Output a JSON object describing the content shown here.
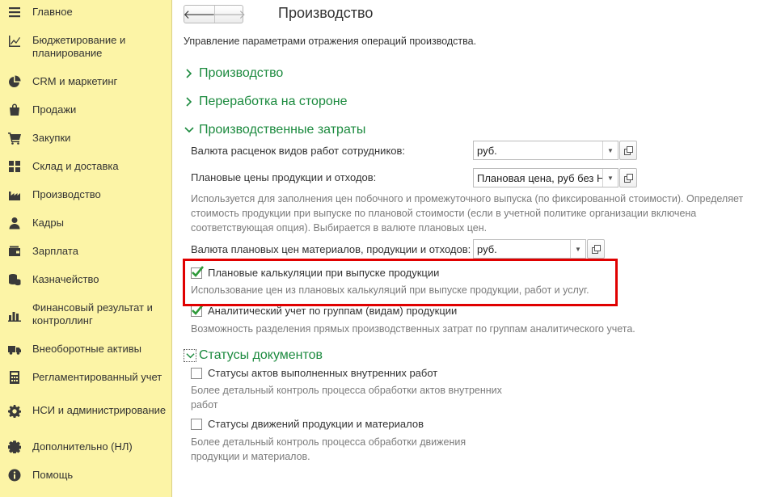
{
  "sidebar": {
    "items": [
      {
        "label": "Главное",
        "icon": "menu-icon"
      },
      {
        "label": "Бюджетирование и планирование",
        "icon": "chart-icon"
      },
      {
        "label": "CRM и маркетинг",
        "icon": "pie-icon"
      },
      {
        "label": "Продажи",
        "icon": "bag-icon"
      },
      {
        "label": "Закупки",
        "icon": "cart-icon"
      },
      {
        "label": "Склад и доставка",
        "icon": "grid-icon"
      },
      {
        "label": "Производство",
        "icon": "factory-icon"
      },
      {
        "label": "Кадры",
        "icon": "person-icon"
      },
      {
        "label": "Зарплата",
        "icon": "wallet-icon"
      },
      {
        "label": "Казначейство",
        "icon": "coins-icon"
      },
      {
        "label": "Финансовый результат и контроллинг",
        "icon": "bar-chart-icon"
      },
      {
        "label": "Внеоборотные активы",
        "icon": "truck-icon"
      },
      {
        "label": "Регламентированный учет",
        "icon": "calculator-icon"
      },
      {
        "label": "НСИ и администрирование",
        "icon": "gear-icon"
      },
      {
        "label": "Дополнительно (НЛ)",
        "icon": "gear-outline-icon"
      },
      {
        "label": "Помощь",
        "icon": "info-icon"
      }
    ]
  },
  "header": {
    "back": "🡐",
    "forward": "🡒",
    "title": "Производство",
    "description": "Управление параметрами отражения операций производства."
  },
  "sections": {
    "production": "Производство",
    "outsourcing": "Переработка на стороне",
    "costs": "Производственные затраты",
    "statuses": "Статусы документов"
  },
  "costs": {
    "rates_currency_label": "Валюта расценок видов работ сотрудников:",
    "rates_currency_value": "руб.",
    "planned_prices_label": "Плановые цены продукции и отходов:",
    "planned_prices_value": "Плановая цена, руб без Н",
    "planned_prices_hint": "Используется для заполнения цен побочного и промежуточного выпуска (по фиксированной стоимости). Определяет стоимость продукции при выпуске по плановой стоимости (если в учетной политике организации включена соответствующая опция). Выбирается в валюте плановых цен.",
    "planned_currency_label": "Валюта плановых цен материалов, продукции и отходов:",
    "planned_currency_value": "руб.",
    "calc_check_label": "Плановые калькуляции при выпуске продукции",
    "calc_check_hint": "Использование цен из плановых калькуляций при выпуске продукции, работ и услуг.",
    "calc_checked": true,
    "analytic_check_label": "Аналитический учет по группам (видам) продукции",
    "analytic_check_hint": "Возможность разделения прямых производственных затрат по группам аналитического учета.",
    "analytic_checked": true
  },
  "statuses": {
    "acts_label": "Статусы актов выполненных внутренних работ",
    "acts_hint": "Более детальный контроль процесса обработки актов внутренних работ",
    "acts_checked": false,
    "movements_label": "Статусы движений продукции и материалов",
    "movements_hint": "Более детальный контроль процесса обработки движения продукции и материалов.",
    "movements_checked": false
  },
  "colors": {
    "sidebar_bg": "#fcf4a6",
    "section_green": "#1b8a3e",
    "highlight_red": "#e00000",
    "check_green": "#2e9a3a"
  }
}
